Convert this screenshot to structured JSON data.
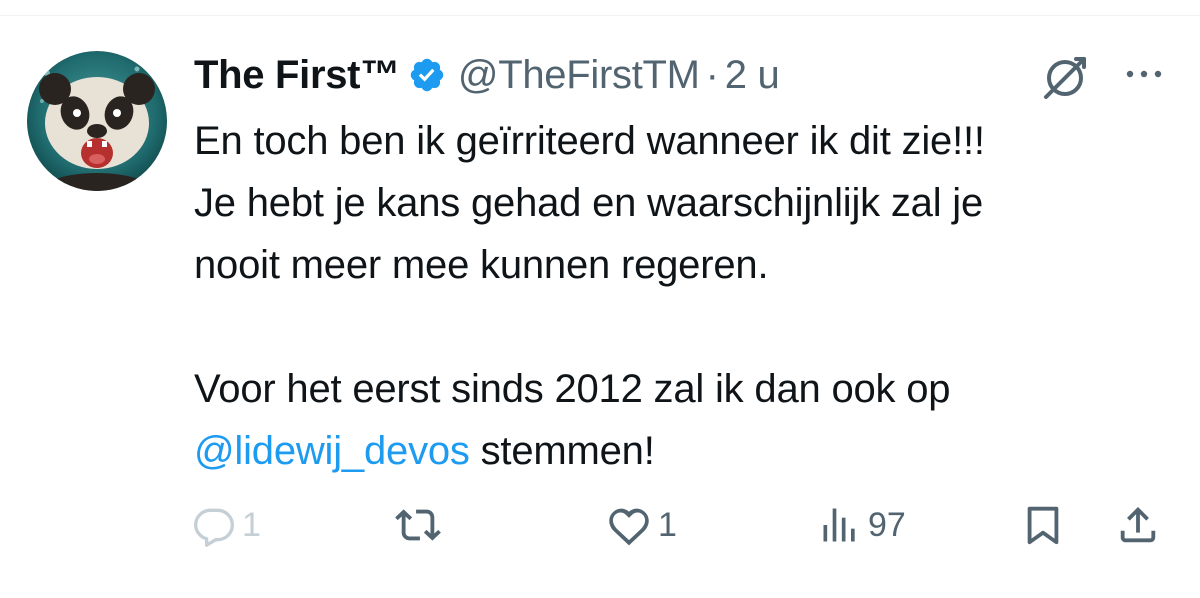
{
  "author": {
    "display_name": "The First™",
    "handle": "@TheFirstTM",
    "separator": "·",
    "time": "2 u",
    "verified": true,
    "avatar_icon": "panda-avatar"
  },
  "tweet": {
    "lines": [
      "En toch ben ik geïrriteerd wanneer ik dit zie!!!",
      "Je hebt je kans gehad en waarschijnlijk zal je",
      "nooit meer mee kunnen regeren.",
      "Voor het eerst sinds 2012 zal ik dan ook op"
    ],
    "mention": "@lidewij_devos",
    "after_mention": " stemmen!"
  },
  "actions": {
    "reply_count": "1",
    "like_count": "1",
    "views_count": "97"
  },
  "icons": {
    "grok": "grok-icon",
    "more": "more-icon",
    "reply": "reply-icon",
    "retweet": "retweet-icon",
    "like": "heart-icon",
    "views": "views-icon",
    "bookmark": "bookmark-icon",
    "share": "share-icon"
  },
  "colors": {
    "text": "#0f1419",
    "secondary": "#536471",
    "link": "#1d9bf0",
    "verified": "#1d9bf0",
    "disabled": "#c4cfd6"
  }
}
